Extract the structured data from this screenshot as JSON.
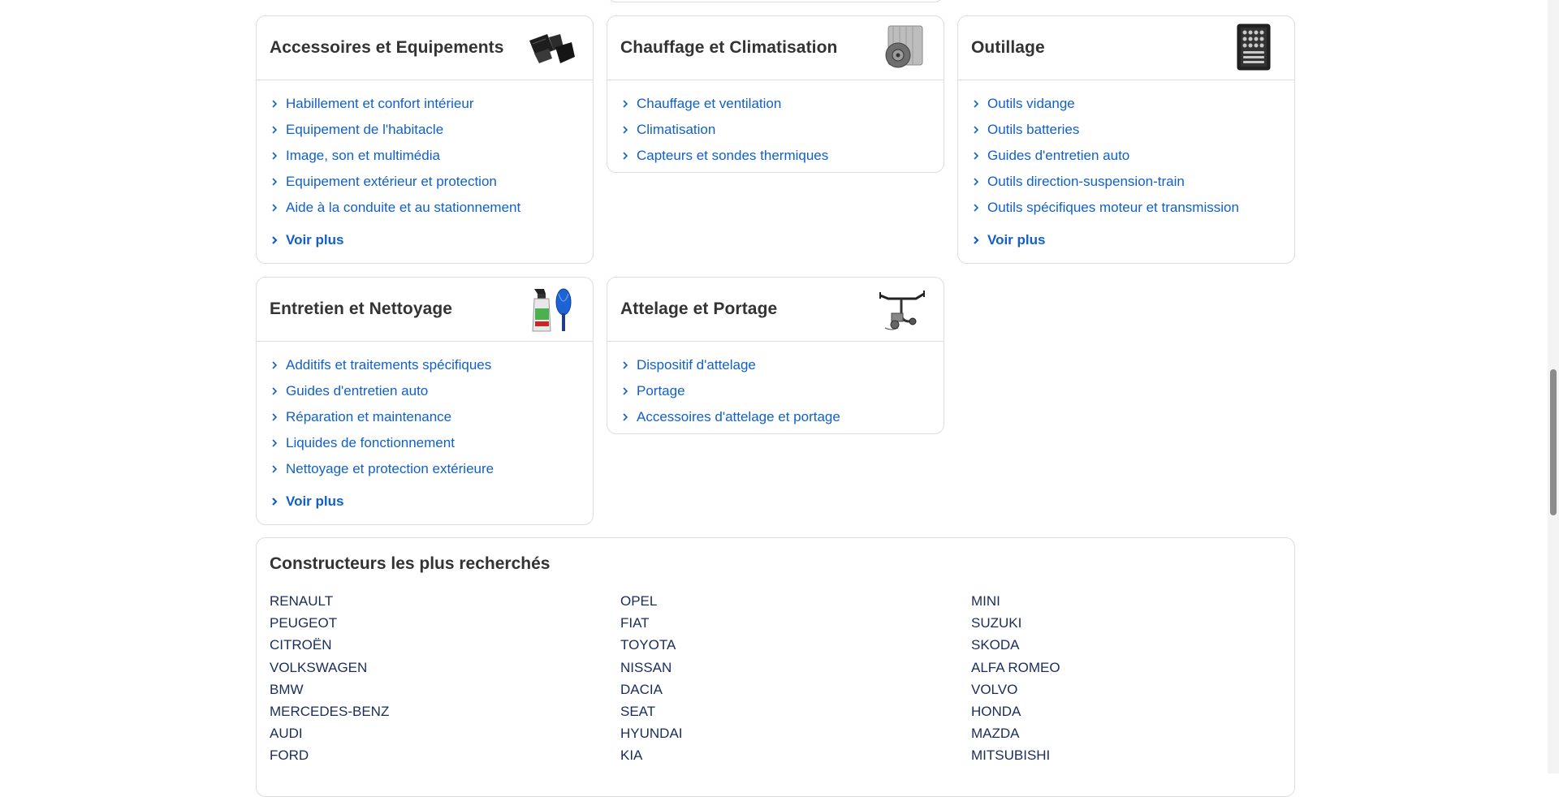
{
  "categories": [
    {
      "title": "Accessoires et Equipements",
      "image": "car-floor-mats-icon",
      "links": [
        "Habillement et confort intérieur",
        "Equipement de l'habitacle",
        "Image, son et multimédia",
        "Equipement extérieur et protection",
        "Aide à la conduite et au stationnement"
      ],
      "more": "Voir plus"
    },
    {
      "title": "Chauffage et Climatisation",
      "image": "ac-compressor-icon",
      "links": [
        "Chauffage et ventilation",
        "Climatisation",
        "Capteurs et sondes thermiques"
      ]
    },
    {
      "title": "Outillage",
      "image": "toolbox-icon",
      "links": [
        "Outils vidange",
        "Outils batteries",
        "Guides d'entretien auto",
        "Outils direction-suspension-train",
        "Outils spécifiques moteur et transmission"
      ],
      "more": "Voir plus"
    },
    {
      "title": "Entretien et Nettoyage",
      "image": "cleaning-spray-icon",
      "links": [
        "Additifs et traitements spécifiques",
        "Guides d'entretien auto",
        "Réparation et maintenance",
        "Liquides de fonctionnement",
        "Nettoyage et protection extérieure"
      ],
      "more": "Voir plus"
    },
    {
      "title": "Attelage et Portage",
      "image": "tow-bar-icon",
      "links": [
        "Dispositif d'attelage",
        "Portage",
        "Accessoires d'attelage et portage"
      ]
    }
  ],
  "brands": {
    "title": "Constructeurs les plus recherchés",
    "columns": [
      [
        "RENAULT",
        "PEUGEOT",
        "CITROËN",
        "VOLKSWAGEN",
        "BMW",
        "MERCEDES-BENZ",
        "AUDI",
        "FORD"
      ],
      [
        "OPEL",
        "FIAT",
        "TOYOTA",
        "NISSAN",
        "DACIA",
        "SEAT",
        "HYUNDAI",
        "KIA"
      ],
      [
        "MINI",
        "SUZUKI",
        "SKODA",
        "ALFA ROMEO",
        "VOLVO",
        "HONDA",
        "MAZDA",
        "MITSUBISHI"
      ]
    ]
  },
  "colors": {
    "link": "#1160c8",
    "brand_text": "#1a2c5a",
    "border": "#dddddd",
    "title": "#333333"
  }
}
